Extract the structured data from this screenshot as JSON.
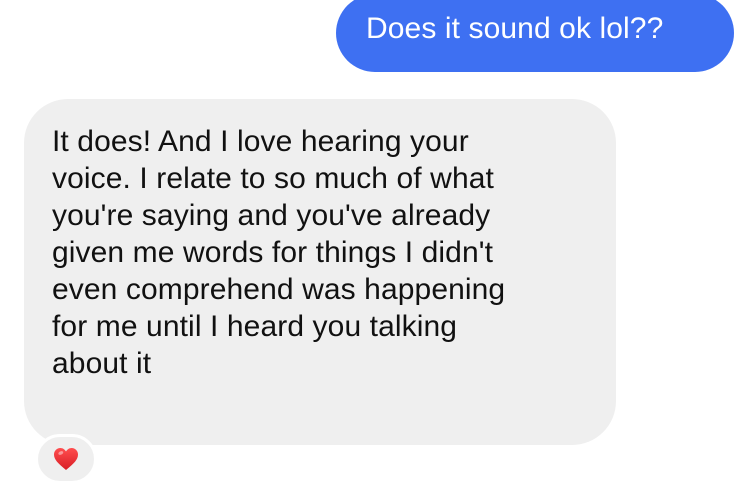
{
  "messages": [
    {
      "direction": "sent",
      "text": "Does it sound ok lol??"
    },
    {
      "direction": "received",
      "text": "It does! And I love hearing your\nvoice. I relate to so much of what\nyou're saying and you've already\ngiven me words for things I didn't\neven comprehend was happening\nfor me until I heard you talking\nabout it",
      "reaction": {
        "icon": "red-heart-icon",
        "color": "#e8262c"
      }
    }
  ],
  "colors": {
    "sent_bubble": "#3e70f2",
    "received_bubble": "#efefef",
    "sent_text": "#ffffff",
    "received_text": "#111111"
  }
}
